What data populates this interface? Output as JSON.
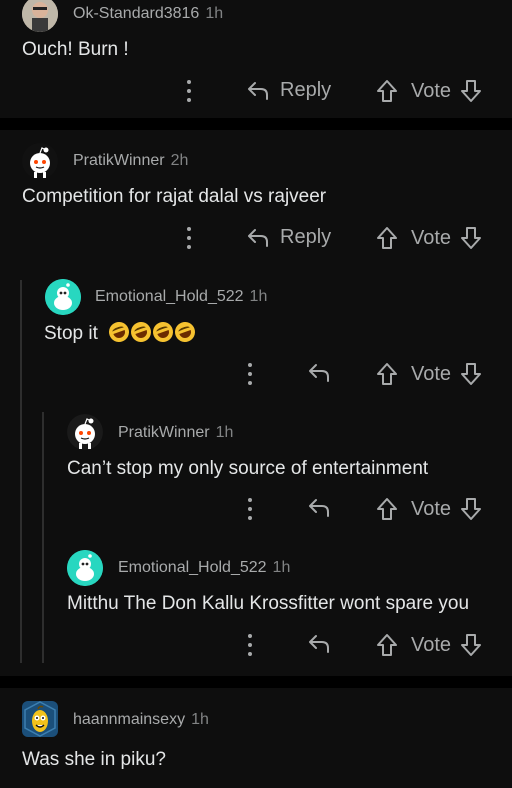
{
  "comments": [
    {
      "username": "Ok-Standard3816",
      "time": "1h",
      "body": "Ouch! Burn !",
      "reply_label": "Reply",
      "vote_label": "Vote"
    },
    {
      "username": "PratikWinner",
      "time": "2h",
      "body": "Competition for rajat dalal vs rajveer",
      "reply_label": "Reply",
      "vote_label": "Vote"
    },
    {
      "username": "Emotional_Hold_522",
      "time": "1h",
      "body": "Stop it",
      "emoji_count": 4,
      "vote_label": "Vote"
    },
    {
      "username": "PratikWinner",
      "time": "1h",
      "body": "Can’t stop my only source of entertainment",
      "vote_label": "Vote"
    },
    {
      "username": "Emotional_Hold_522",
      "time": "1h",
      "body": "Mitthu The Don Kallu Krossfitter wont spare you",
      "vote_label": "Vote"
    },
    {
      "username": "haannmainsexy",
      "time": "1h",
      "body": "Was she in piku?"
    }
  ],
  "colors": {
    "background": "#000000",
    "card": "#0e0e0e",
    "text": "#e4e6e7",
    "muted": "#a8aaab",
    "teal_avatar": "#28d7c0"
  }
}
